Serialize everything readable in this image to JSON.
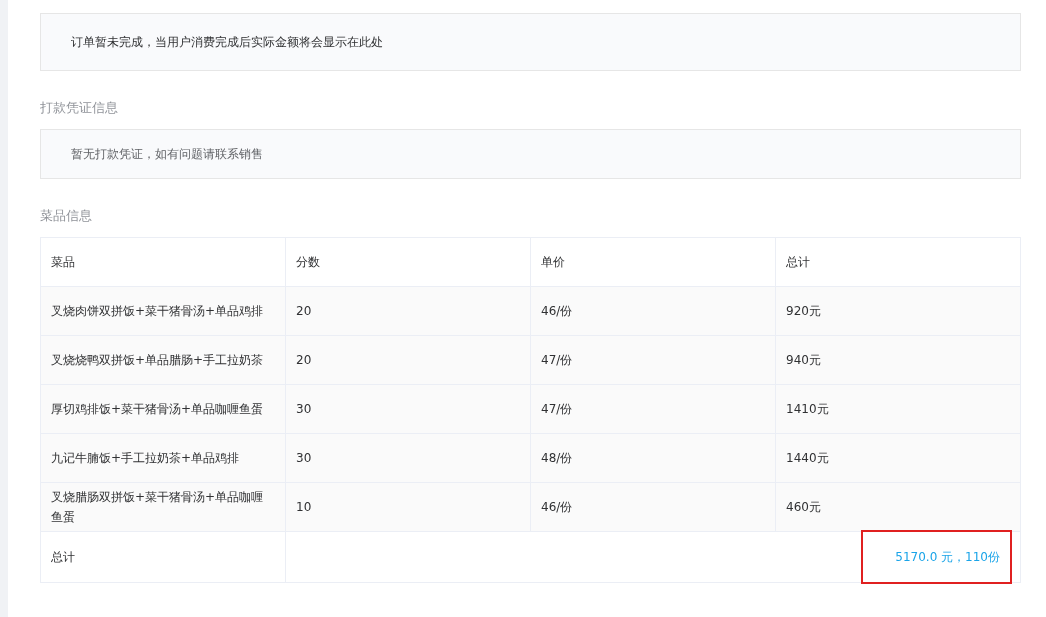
{
  "notice": "订单暂未完成，当用户消费完成后实际金额将会显示在此处",
  "voucher": {
    "title": "打款凭证信息",
    "message": "暂无打款凭证，如有问题请联系销售"
  },
  "dishes": {
    "title": "菜品信息",
    "columns": [
      "菜品",
      "分数",
      "单价",
      "总计"
    ],
    "rows": [
      [
        "叉烧肉饼双拼饭+菜干猪骨汤+单品鸡排",
        "20",
        "46/份",
        "920元"
      ],
      [
        "叉烧烧鸭双拼饭+单品腊肠+手工拉奶茶",
        "20",
        "47/份",
        "940元"
      ],
      [
        "厚切鸡排饭+菜干猪骨汤+单品咖喱鱼蛋",
        "30",
        "47/份",
        "1410元"
      ],
      [
        "九记牛腩饭+手工拉奶茶+单品鸡排",
        "30",
        "48/份",
        "1440元"
      ],
      [
        "叉烧腊肠双拼饭+菜干猪骨汤+单品咖喱鱼蛋",
        "10",
        "46/份",
        "460元"
      ]
    ],
    "total": {
      "label": "总计",
      "value": "5170.0 元，110份",
      "highlighted": true
    }
  }
}
